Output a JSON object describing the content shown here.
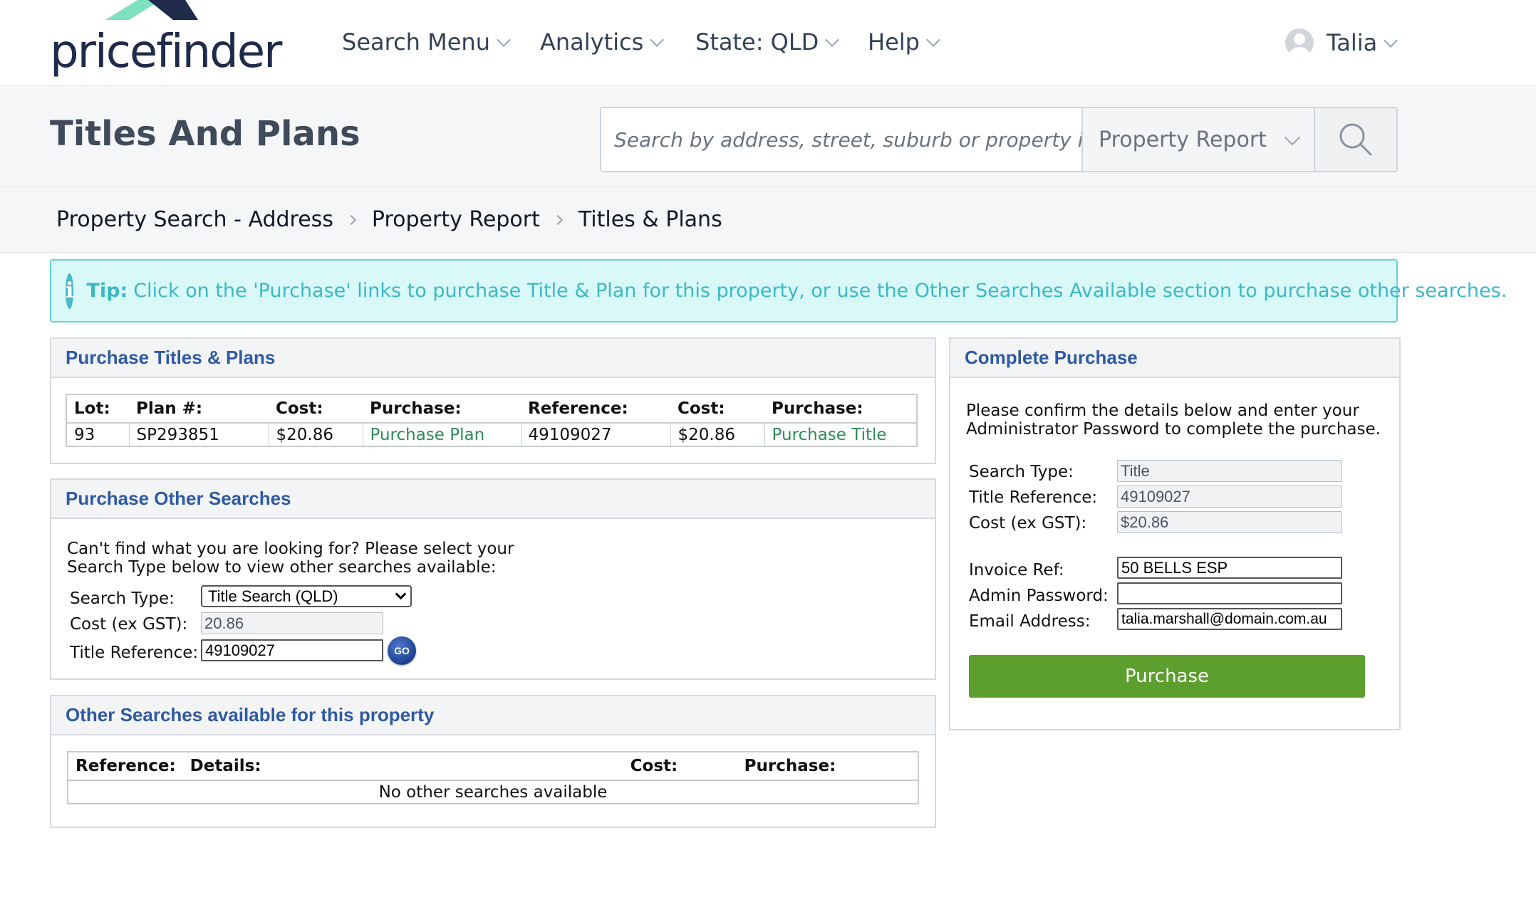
{
  "brand": {
    "name": "pricefinder",
    "colors": {
      "navy": "#1e2b4a",
      "mint": "#7fe0c0"
    }
  },
  "nav": {
    "items": [
      {
        "label": "Search Menu"
      },
      {
        "label": "Analytics"
      },
      {
        "label": "State: QLD"
      },
      {
        "label": "Help"
      }
    ],
    "user": "Talia"
  },
  "header": {
    "title": "Titles And Plans",
    "search_placeholder": "Search by address, street, suburb or property id",
    "report_type": "Property Report"
  },
  "breadcrumb": [
    "Property Search - Address",
    "Property Report",
    "Titles & Plans"
  ],
  "tip": {
    "label": "Tip:",
    "text": "Click on the 'Purchase' links to purchase Title & Plan for this property, or use the Other Searches Available section to purchase other searches."
  },
  "titles_plans": {
    "heading": "Purchase Titles & Plans",
    "columns": [
      "Lot:",
      "Plan #:",
      "Cost:",
      "Purchase:",
      "Reference:",
      "Cost:",
      "Purchase:"
    ],
    "row": {
      "lot": "93",
      "plan": "SP293851",
      "plan_cost": "$20.86",
      "plan_link": "Purchase Plan",
      "reference": "49109027",
      "title_cost": "$20.86",
      "title_link": "Purchase Title"
    }
  },
  "other_searches": {
    "heading": "Purchase Other Searches",
    "intro_line1": "Can't find what you are looking for? Please select your",
    "intro_line2": "Search Type below to view other searches available:",
    "search_type_label": "Search Type:",
    "search_type_value": "Title Search (QLD)",
    "cost_label": "Cost (ex GST):",
    "cost_value": "20.86",
    "title_ref_label": "Title Reference:",
    "title_ref_value": "49109027",
    "go_label": "GO"
  },
  "available": {
    "heading": "Other Searches available for this property",
    "columns": [
      "Reference:",
      "Details:",
      "Cost:",
      "Purchase:"
    ],
    "empty": "No other searches available"
  },
  "complete": {
    "heading": "Complete Purchase",
    "intro_line1": "Please confirm the details below and enter your",
    "intro_line2": "Administrator Password to complete the purchase.",
    "search_type_label": "Search Type:",
    "search_type_value": "Title",
    "title_ref_label": "Title Reference:",
    "title_ref_value": "49109027",
    "cost_label": "Cost (ex GST):",
    "cost_value": "$20.86",
    "invoice_label": "Invoice Ref:",
    "invoice_value": "50 BELLS ESP",
    "password_label": "Admin Password:",
    "password_value": "",
    "email_label": "Email Address:",
    "email_value": "talia.marshall@domain.com.au",
    "button": "Purchase"
  }
}
